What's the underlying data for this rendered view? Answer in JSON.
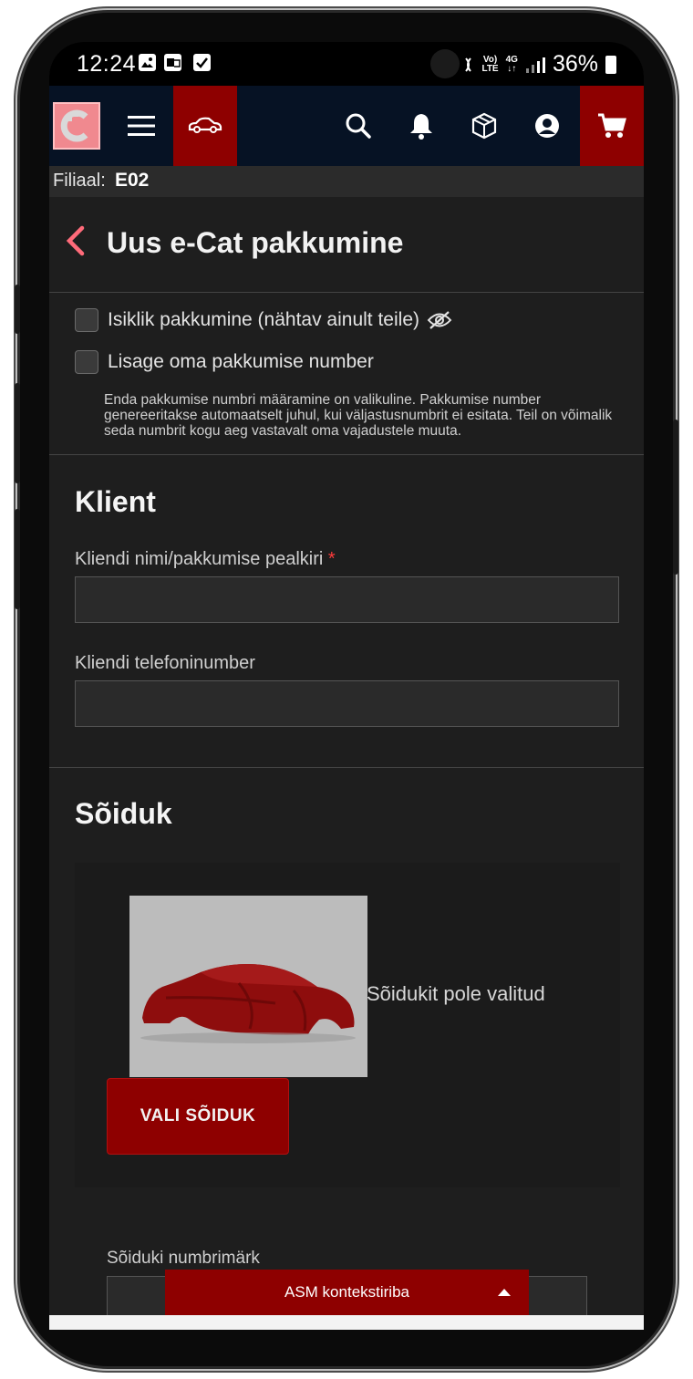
{
  "status_bar": {
    "time": "12:24",
    "network_top": "Vo)",
    "network_bottom": "LTE",
    "network_gen": "4G",
    "battery": "36%"
  },
  "topnav": {
    "icons": [
      "logo-icon",
      "menu-icon",
      "car-icon",
      "search-icon",
      "bell-icon",
      "package-icon",
      "user-icon",
      "cart-icon"
    ],
    "accent": "#8e0000",
    "background": "#061224"
  },
  "filiaal": {
    "label": "Filiaal:",
    "value": "E02"
  },
  "page": {
    "title": "Uus e-Cat pakkumine",
    "checkboxes": [
      {
        "label": "Isiklik pakkumine (nähtav ainult teile)",
        "checked": false
      },
      {
        "label": "Lisage oma pakkumise number",
        "checked": false
      }
    ],
    "help_text": "Enda pakkumise numbri määramine on valikuline. Pakkumise number genereeritakse automaatselt juhul, kui väljastusnumbrit ei esitata. Teil on võimalik seda numbrit kogu aeg vastavalt oma vajadustele muuta."
  },
  "client": {
    "title": "Klient",
    "name_label": "Kliendi nimi/pakkumise pealkiri",
    "required_mark": "*",
    "name_value": "",
    "phone_label": "Kliendi telefoninumber",
    "phone_value": ""
  },
  "vehicle": {
    "title": "Sõiduk",
    "none_text": "Sõidukit pole valitud",
    "select_button": "VALI SÕIDUK",
    "plate_label": "Sõiduki numbrimärk",
    "plate_value": ""
  },
  "asm_bar": {
    "label": "ASM kontekstiriba"
  }
}
